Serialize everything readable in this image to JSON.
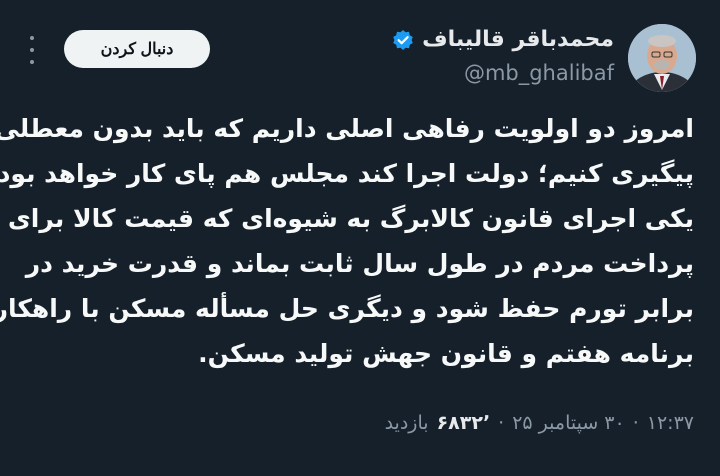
{
  "author": {
    "display_name": "محمدباقر قالیباف",
    "handle": "@mb_ghalibaf",
    "verified": true
  },
  "actions": {
    "follow_label": "دنبال کردن"
  },
  "tweet": {
    "lines": [
      "امروز دو اولویت رفاهی اصلی داریم که باید بدون معطلی",
      "پیگیری کنیم؛ دولت اجرا کند مجلس هم پای کار خواهد بود.",
      "یکی اجرای قانون کالابرگ به شیوه‌ای که قیمت کالا برای",
      "پرداخت مردم در طول سال ثابت بماند و قدرت خرید در",
      "برابر تورم حفظ شود و دیگری حل مسأله مسکن با راهکار",
      "برنامه هفتم و قانون جهش تولید مسکن."
    ]
  },
  "meta": {
    "time": "۱۲:۳۷",
    "date": "۳۰ سپتامبر ۲۵",
    "separator": "·",
    "views_count": "۶۸۳۲٬",
    "views_label": "بازدید"
  },
  "colors": {
    "background": "#15202b",
    "verified": "#1d9bf0",
    "muted_text": "#8b98a5"
  },
  "icons": {
    "verified": "verified-badge-icon",
    "more": "more-options-icon"
  }
}
